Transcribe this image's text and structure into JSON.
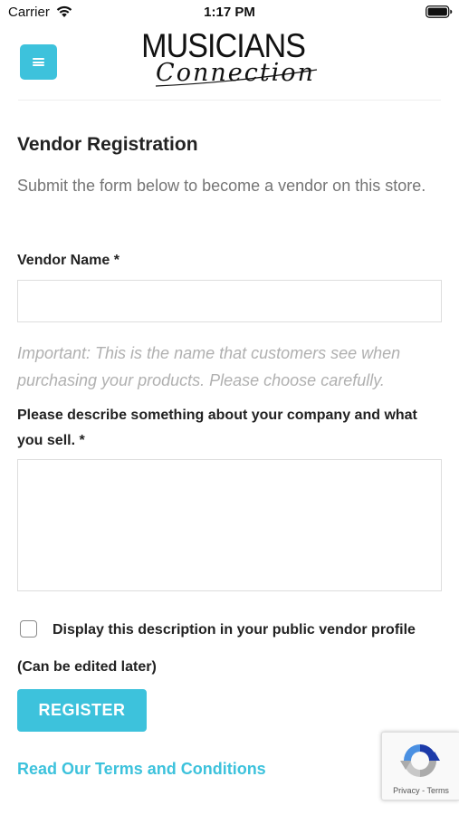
{
  "status_bar": {
    "carrier": "Carrier",
    "time": "1:17 PM"
  },
  "header": {
    "logo_top": "MUSICIANS",
    "logo_script": "Connection",
    "accent_color": "#3dc2dc"
  },
  "form": {
    "title": "Vendor Registration",
    "intro": "Submit the form below to become a vendor on this store.",
    "vendor_name_label": "Vendor Name *",
    "vendor_name_value": "",
    "vendor_name_hint": "Important: This is the name that customers see when purchasing your products. Please choose carefully.",
    "description_label": "Please describe something about your company and what you sell. *",
    "description_value": "",
    "display_checkbox_label": "Display this description in your public vendor profile",
    "display_checkbox_checked": false,
    "edit_note": "(Can be edited later)",
    "register_label": "REGISTER",
    "terms_link": "Read Our Terms and Conditions"
  },
  "recaptcha": {
    "privacy": "Privacy",
    "separator": "-",
    "terms": "Terms"
  }
}
